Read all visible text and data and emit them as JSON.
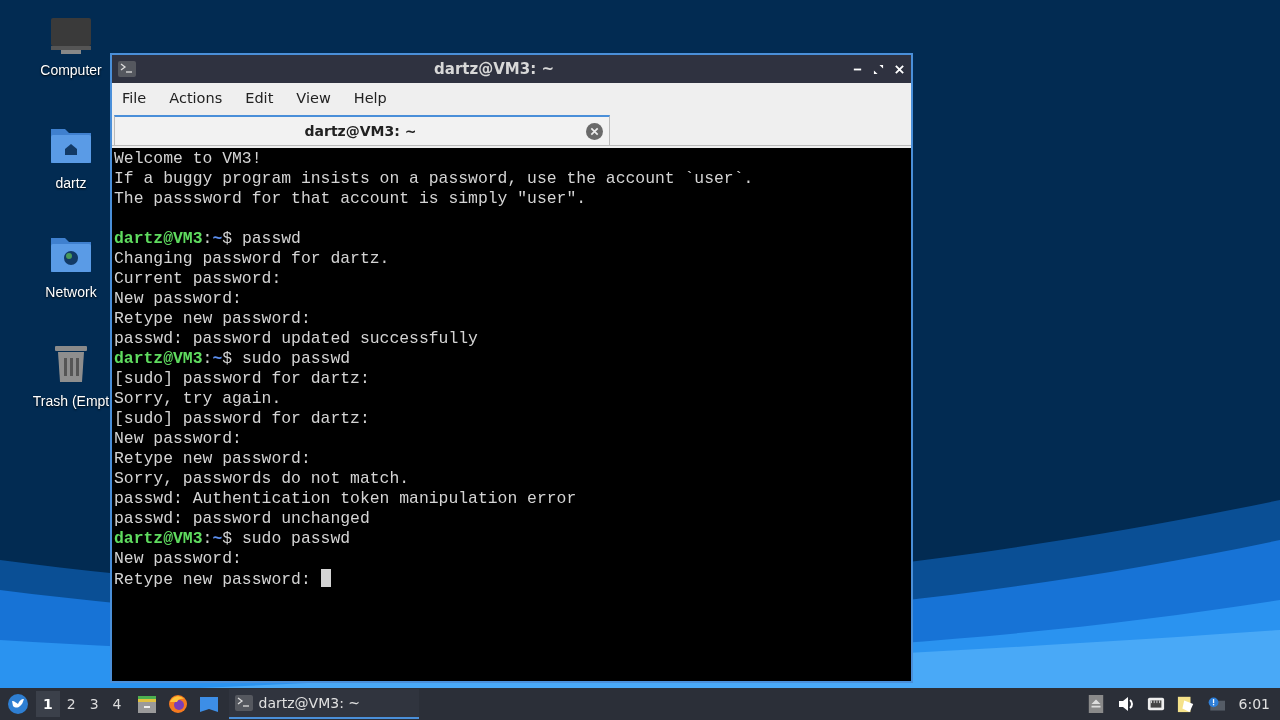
{
  "desktop_icons": [
    {
      "label": "Computer",
      "kind": "computer"
    },
    {
      "label": "dartz",
      "kind": "home"
    },
    {
      "label": "Network",
      "kind": "network"
    },
    {
      "label": "Trash (Empt",
      "kind": "trash"
    }
  ],
  "window": {
    "title": "dartz@VM3: ~",
    "menu": [
      "File",
      "Actions",
      "Edit",
      "View",
      "Help"
    ],
    "tabs": [
      {
        "label": "dartz@VM3: ~",
        "selected": true
      }
    ],
    "terminal": {
      "lines": [
        {
          "kind": "output",
          "text": "Welcome to VM3!"
        },
        {
          "kind": "output",
          "text": "If a buggy program insists on a password, use the account `user`."
        },
        {
          "kind": "output",
          "text": "The passsword for that account is simply \"user\"."
        },
        {
          "kind": "blank"
        },
        {
          "kind": "command",
          "prompt": {
            "user_host": "dartz@VM3",
            "separator": ":",
            "path": "~",
            "symbol": "$"
          },
          "text": "passwd"
        },
        {
          "kind": "output",
          "text": "Changing password for dartz."
        },
        {
          "kind": "output",
          "text": "Current password:"
        },
        {
          "kind": "output",
          "text": "New password:"
        },
        {
          "kind": "output",
          "text": "Retype new password:"
        },
        {
          "kind": "output",
          "text": "passwd: password updated successfully"
        },
        {
          "kind": "command",
          "prompt": {
            "user_host": "dartz@VM3",
            "separator": ":",
            "path": "~",
            "symbol": "$"
          },
          "text": "sudo passwd"
        },
        {
          "kind": "output",
          "text": "[sudo] password for dartz:"
        },
        {
          "kind": "output",
          "text": "Sorry, try again."
        },
        {
          "kind": "output",
          "text": "[sudo] password for dartz:"
        },
        {
          "kind": "output",
          "text": "New password:"
        },
        {
          "kind": "output",
          "text": "Retype new password:"
        },
        {
          "kind": "output",
          "text": "Sorry, passwords do not match."
        },
        {
          "kind": "output",
          "text": "passwd: Authentication token manipulation error"
        },
        {
          "kind": "output",
          "text": "passwd: password unchanged"
        },
        {
          "kind": "command",
          "prompt": {
            "user_host": "dartz@VM3",
            "separator": ":",
            "path": "~",
            "symbol": "$"
          },
          "text": "sudo passwd"
        },
        {
          "kind": "output",
          "text": "New password:"
        },
        {
          "kind": "output",
          "text": "Retype new password: ",
          "cursor": true
        }
      ]
    }
  },
  "taskbar": {
    "workspaces": [
      {
        "label": "1",
        "selected": true
      },
      {
        "label": "2",
        "selected": false
      },
      {
        "label": "3",
        "selected": false
      },
      {
        "label": "4",
        "selected": false
      }
    ],
    "launchers": [
      {
        "kind": "files"
      },
      {
        "kind": "browser"
      },
      {
        "kind": "desktop"
      }
    ],
    "tasks": [
      {
        "label": "dartz@VM3: ~",
        "selected": true
      }
    ],
    "tray": [
      {
        "kind": "eject"
      },
      {
        "kind": "volume"
      },
      {
        "kind": "network"
      },
      {
        "kind": "clipboard"
      },
      {
        "kind": "notification"
      }
    ],
    "clock": "6:01"
  }
}
